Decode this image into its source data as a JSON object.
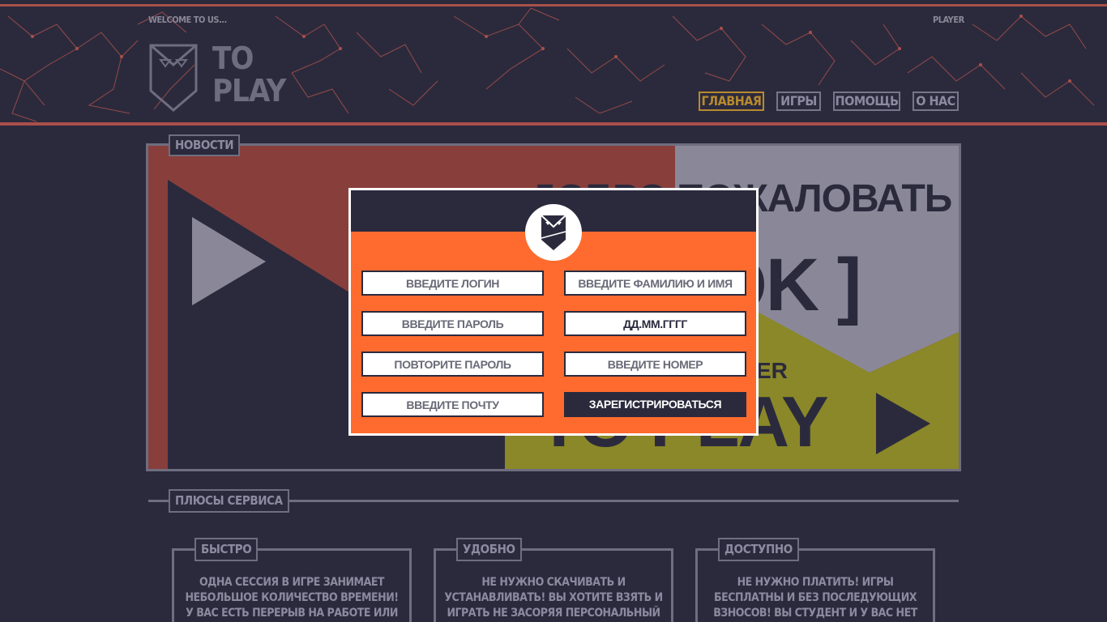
{
  "header": {
    "welcome_text": "WELCOME TO US...",
    "player_text": "PLAYER",
    "logo_line1": "TO",
    "logo_line2": "PLAY"
  },
  "nav": {
    "items": [
      {
        "label": "ГЛАВНАЯ",
        "active": true
      },
      {
        "label": "ИГРЫ",
        "active": false
      },
      {
        "label": "ПОМОЩЬ",
        "active": false
      },
      {
        "label": "О НАС",
        "active": false
      }
    ]
  },
  "news": {
    "label": "НОВОСТИ",
    "banner_line1": "ДОБРО ПОЖАЛОВАТЬ",
    "banner_line2": "[ OK ]",
    "banner_line3": "ER",
    "banner_line4": "TO PLAY"
  },
  "advantages": {
    "label": "ПЛЮСЫ СЕРВИСА",
    "cards": [
      {
        "title": "БЫСТРО",
        "text": "ОДНА СЕССИЯ В ИГРЕ ЗАНИМАЕТ НЕБОЛЬШОЕ КОЛИЧЕСТВО ВРЕМЕНИ! У ВАС ЕСТЬ ПЕРЕРЫВ НА РАБОТЕ ИЛИ ХОТИТЕ"
      },
      {
        "title": "УДОБНО",
        "text": "НЕ НУЖНО СКАЧИВАТЬ И УСТАНАВЛИВАТЬ! ВЫ ХОТИТЕ ВЗЯТЬ И ИГРАТЬ НЕ ЗАСОРЯЯ ПЕРСОНАЛЬНЫЙ КОМПЬЮТЕР? ТАК ЧЕГО"
      },
      {
        "title": "ДОСТУПНО",
        "text": "НЕ НУЖНО ПЛАТИТЬ! ИГРЫ БЕСПЛАТНЫ И БЕЗ ПОСЛЕДУЮЩИХ ВЗНОСОВ! ВЫ СТУДЕНТ И У ВАС НЕТ ДЕНЕГ? МЫ"
      }
    ]
  },
  "modal": {
    "login_placeholder": "ВВЕДИТЕ ЛОГИН",
    "password_placeholder": "ВВЕДИТЕ ПАРОЛЬ",
    "repeat_password_placeholder": "ПОВТОРИТЕ ПАРОЛЬ",
    "email_placeholder": "ВВЕДИТЕ ПОЧТУ",
    "fullname_placeholder": "ВВЕДИТЕ ФАМИЛИЮ И ИМЯ",
    "birthdate_value": "ДД.ММ.ГГГГ",
    "phone_placeholder": "ВВЕДИТЕ НОМЕР",
    "register_label": "ЗАРЕГИСТРИРОВАТЬСЯ"
  },
  "colors": {
    "background": "#2b2a3d",
    "accent_red": "#a8504a",
    "modal_orange": "#ff6b2e",
    "nav_active": "#b88a2e",
    "border_gray": "#6f6d80"
  }
}
